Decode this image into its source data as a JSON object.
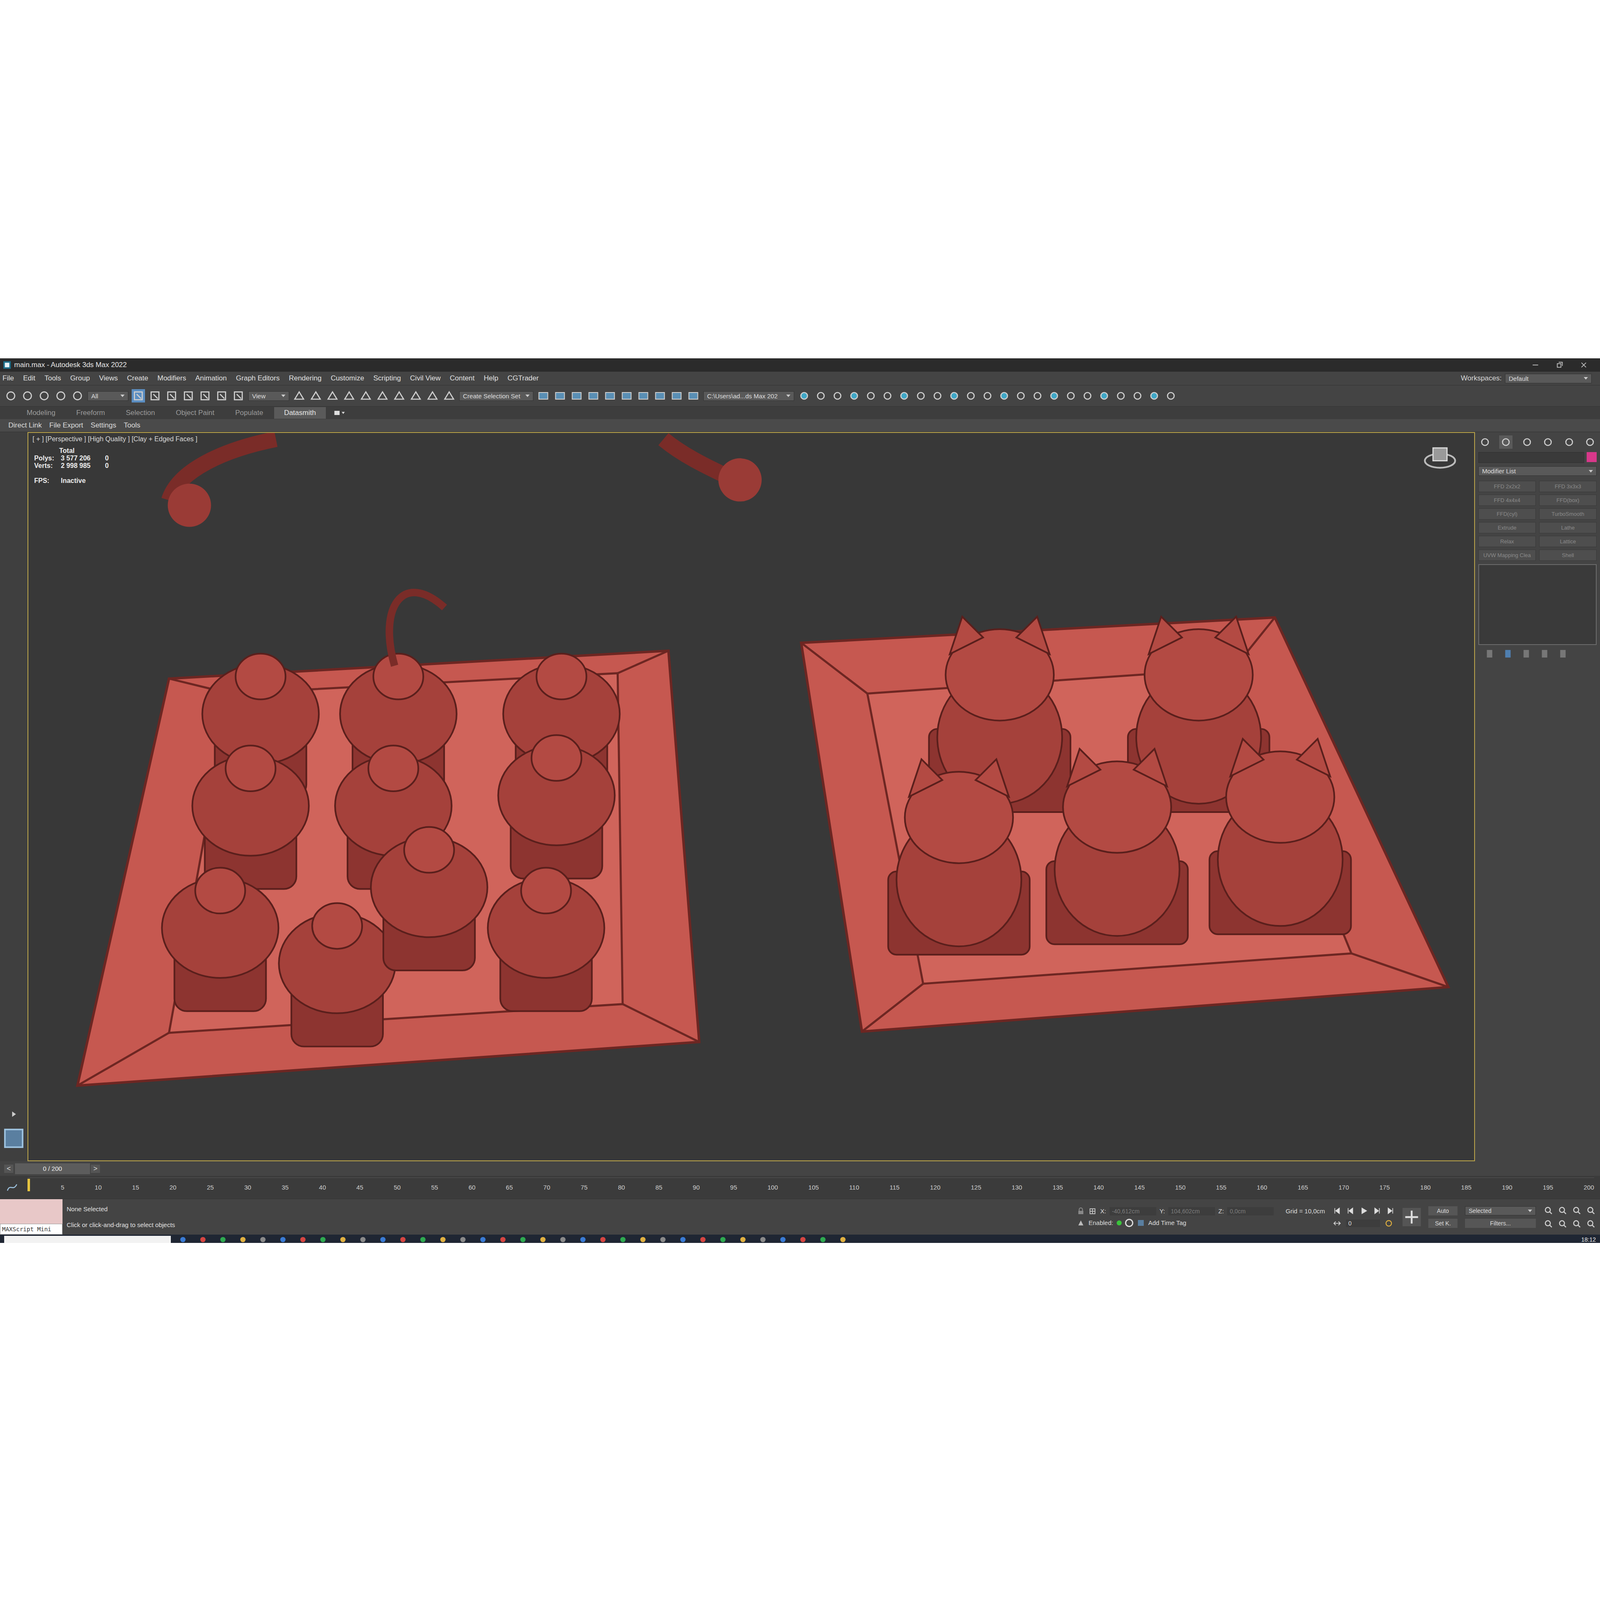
{
  "window": {
    "title": "main.max - Autodesk 3ds Max 2022",
    "workspaces_label": "Workspaces:",
    "workspace": "Default"
  },
  "menu": [
    "File",
    "Edit",
    "Tools",
    "Group",
    "Views",
    "Create",
    "Modifiers",
    "Animation",
    "Graph Editors",
    "Rendering",
    "Customize",
    "Scripting",
    "Civil View",
    "Content",
    "Help",
    "CGTrader"
  ],
  "toolbar": {
    "filter": "All",
    "coord_system": "View",
    "selection_set": "Create Selection Set",
    "project_path": "C:\\Users\\ad...ds Max 202"
  },
  "ribbon_tabs": [
    {
      "label": "Modeling",
      "selected": false
    },
    {
      "label": "Freeform",
      "selected": false
    },
    {
      "label": "Selection",
      "selected": false
    },
    {
      "label": "Object Paint",
      "selected": false
    },
    {
      "label": "Populate",
      "selected": false
    },
    {
      "label": "Datasmith",
      "selected": true
    }
  ],
  "ribbon_row": [
    "Direct Link",
    "File Export",
    "Settings",
    "Tools"
  ],
  "viewport": {
    "label": "[ + ] [Perspective ] [High Quality ] [Clay + Edged Faces ]",
    "stats_title": "Total",
    "stats": [
      {
        "name": "Polys:",
        "value": "3 577 206",
        "selected_value": "0"
      },
      {
        "name": "Verts:",
        "value": "2 998 985",
        "selected_value": "0"
      }
    ],
    "fps_label": "FPS:",
    "fps": "Inactive"
  },
  "command_panel": {
    "dropdown": "Modifier List",
    "buttons": [
      "FFD 2x2x2",
      "FFD 3x3x3",
      "FFD 4x4x4",
      "FFD(box)",
      "FFD(cyl)",
      "TurboSmooth",
      "Extrude",
      "Lathe",
      "Relax",
      "Lattice",
      "UVW Mapping Clea",
      "Shell"
    ]
  },
  "timeline": {
    "slider": "0 / 200",
    "prev": "<",
    "next": ">",
    "level": 0,
    "ticks": [
      "5",
      "10",
      "15",
      "20",
      "25",
      "30",
      "35",
      "40",
      "45",
      "50",
      "55",
      "60",
      "65",
      "70",
      "75",
      "80",
      "85",
      "90",
      "95",
      "100",
      "105",
      "110",
      "115",
      "120",
      "125",
      "130",
      "135",
      "140",
      "145",
      "150",
      "155",
      "160",
      "165",
      "170",
      "175",
      "180",
      "185",
      "190",
      "195",
      "200"
    ]
  },
  "status_bar": {
    "maxscript": "MAXScript Mini",
    "selection": "None Selected",
    "prompt": "Click or click-and-drag to select objects",
    "coords": [
      {
        "axis": "X:",
        "value": "-40,612cm"
      },
      {
        "axis": "Y:",
        "value": "104,602cm"
      },
      {
        "axis": "Z:",
        "value": "0,0cm"
      }
    ],
    "grid": "Grid = 10,0cm",
    "enabled": "Enabled:",
    "time_tag": "Add Time Tag",
    "frame": "0",
    "auto": "Auto",
    "set_key": "Set K.",
    "key_filter": "Selected",
    "filters": "Filters..."
  },
  "taskbar": {
    "time": "18:12"
  }
}
